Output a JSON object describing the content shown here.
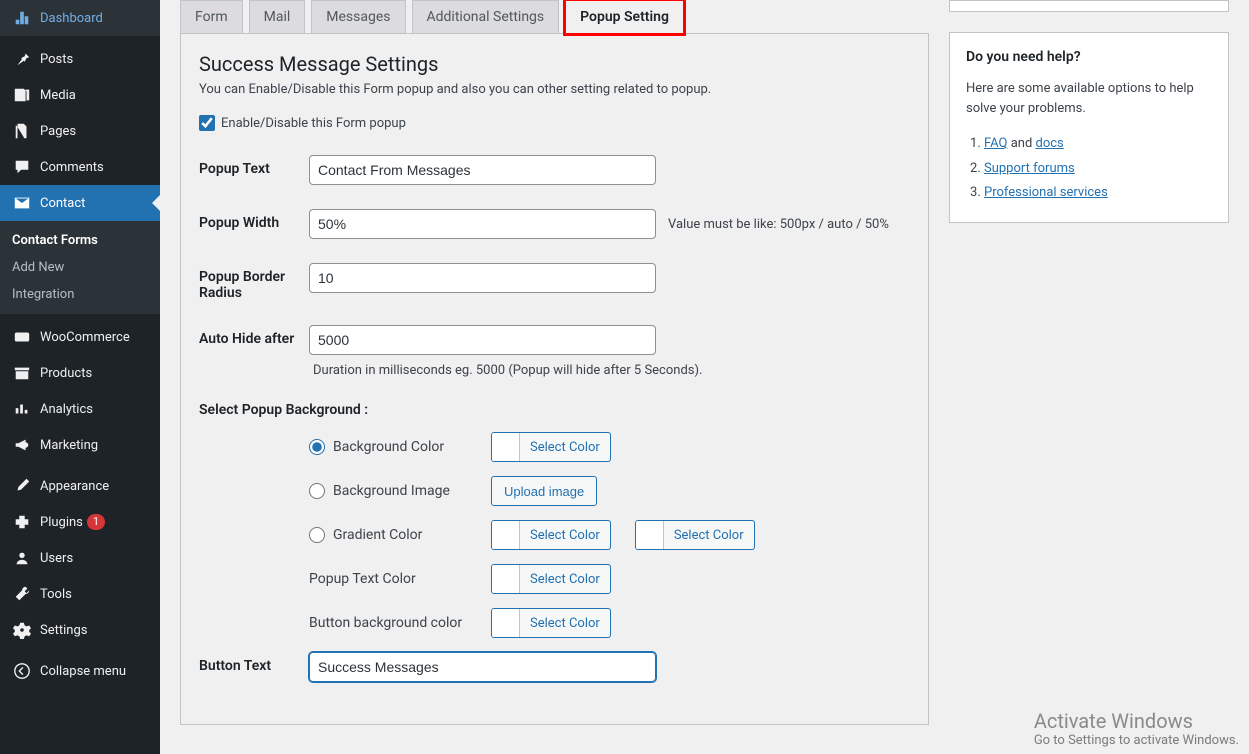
{
  "sidebar": {
    "items": [
      {
        "label": "Dashboard",
        "icon": "dashboard"
      },
      {
        "label": "Posts",
        "icon": "pin"
      },
      {
        "label": "Media",
        "icon": "media"
      },
      {
        "label": "Pages",
        "icon": "pages"
      },
      {
        "label": "Comments",
        "icon": "comments"
      },
      {
        "label": "Contact",
        "icon": "mail",
        "active": true
      },
      {
        "label": "WooCommerce",
        "icon": "woo"
      },
      {
        "label": "Products",
        "icon": "archive"
      },
      {
        "label": "Analytics",
        "icon": "analytics"
      },
      {
        "label": "Marketing",
        "icon": "megaphone"
      },
      {
        "label": "Appearance",
        "icon": "brush"
      },
      {
        "label": "Plugins",
        "icon": "plugin",
        "badge": "1"
      },
      {
        "label": "Users",
        "icon": "users"
      },
      {
        "label": "Tools",
        "icon": "tools"
      },
      {
        "label": "Settings",
        "icon": "settings"
      },
      {
        "label": "Collapse menu",
        "icon": "collapse"
      }
    ],
    "submenu": [
      {
        "label": "Contact Forms",
        "active": true
      },
      {
        "label": "Add New"
      },
      {
        "label": "Integration"
      }
    ]
  },
  "tabs": [
    {
      "label": "Form"
    },
    {
      "label": "Mail"
    },
    {
      "label": "Messages"
    },
    {
      "label": "Additional Settings"
    },
    {
      "label": "Popup Setting",
      "active": true,
      "highlighted": true
    }
  ],
  "panel": {
    "title": "Success Message Settings",
    "description": "You can Enable/Disable this Form popup and also you can other setting related to popup.",
    "enable_label": "Enable/Disable this Form popup",
    "enable_checked": true,
    "fields": {
      "popup_text": {
        "label": "Popup Text",
        "value": "Contact From Messages"
      },
      "popup_width": {
        "label": "Popup Width",
        "value": "50%",
        "hint": "Value must be like: 500px / auto / 50%"
      },
      "popup_border_radius": {
        "label": "Popup Border Radius",
        "value": "10"
      },
      "auto_hide": {
        "label": "Auto Hide after",
        "value": "5000",
        "hint": "Duration in milliseconds eg. 5000 (Popup will hide after 5 Seconds)."
      },
      "button_text": {
        "label": "Button Text",
        "value": "Success Messages"
      }
    },
    "bg_section": {
      "title": "Select Popup Background :",
      "options": {
        "bg_color": {
          "label": "Background Color",
          "checked": true,
          "button": "Select Color"
        },
        "bg_image": {
          "label": "Background Image",
          "button": "Upload image"
        },
        "gradient": {
          "label": "Gradient Color",
          "button1": "Select Color",
          "button2": "Select Color"
        },
        "text_color": {
          "label": "Popup Text Color",
          "button": "Select Color"
        },
        "btn_bg": {
          "label": "Button background color",
          "button": "Select Color"
        }
      }
    }
  },
  "help": {
    "title": "Do you need help?",
    "intro": "Here are some available options to help solve your problems.",
    "links": {
      "faq": "FAQ",
      "and": " and ",
      "docs": "docs",
      "support": "Support forums",
      "pro": "Professional services"
    }
  },
  "watermark": {
    "line1": "Activate Windows",
    "line2": "Go to Settings to activate Windows."
  }
}
